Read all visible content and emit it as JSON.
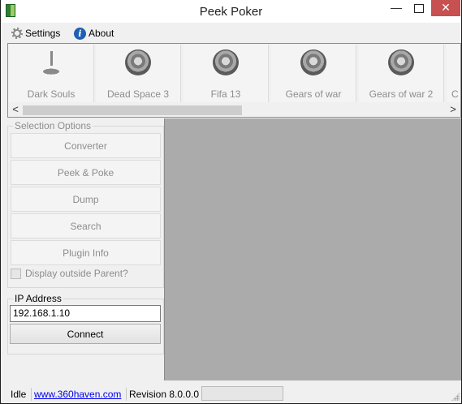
{
  "window": {
    "title": "Peek Poker",
    "minimize_glyph": "—",
    "close_glyph": "✕"
  },
  "menu": {
    "settings": "Settings",
    "about": "About",
    "about_icon_glyph": "i"
  },
  "gallery": {
    "tiles": [
      {
        "label": "Dark Souls",
        "icon": "bonfire-icon"
      },
      {
        "label": "Dead Space 3",
        "icon": "disc-icon"
      },
      {
        "label": "Fifa 13",
        "icon": "disc-icon"
      },
      {
        "label": "Gears of war",
        "icon": "disc-icon"
      },
      {
        "label": "Gears of war 2",
        "icon": "disc-icon"
      },
      {
        "label": "C",
        "icon": "disc-icon"
      }
    ],
    "scroll_left_glyph": "<",
    "scroll_right_glyph": ">"
  },
  "selection": {
    "legend": "Selection Options",
    "buttons": [
      "Converter",
      "Peek & Poke",
      "Dump",
      "Search",
      "Plugin Info"
    ],
    "checkbox_label": "Display outside Parent?"
  },
  "ip": {
    "legend": "IP Address",
    "value": "192.168.1.10",
    "connect": "Connect"
  },
  "status": {
    "state": "Idle",
    "link": "www.360haven.com",
    "revision": "Revision 8.0.0.0"
  },
  "colors": {
    "close_button": "#c75050",
    "content_background": "#ababab",
    "link": "#0000ee"
  }
}
